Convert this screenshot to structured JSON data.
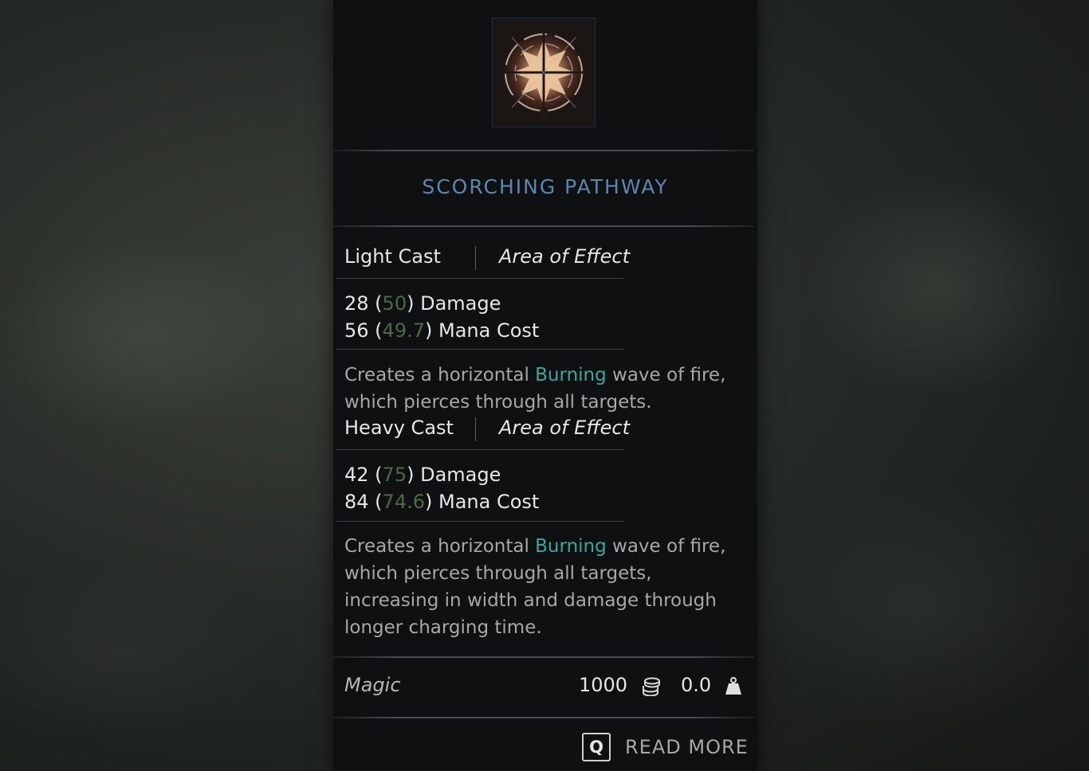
{
  "skill": {
    "name": "SCORCHING PATHWAY",
    "icon": "fire-burst-icon"
  },
  "light_cast": {
    "label": "Light Cast",
    "type": "Area of Effect",
    "damage_base": "28",
    "damage_scaled": "50",
    "damage_label": "Damage",
    "mana_base": "56",
    "mana_scaled": "49.7",
    "mana_label": "Mana Cost",
    "desc_pre": "Creates a horizontal ",
    "desc_keyword": "Burning",
    "desc_post": " wave of fire, which pierces through all targets."
  },
  "heavy_cast": {
    "label": "Heavy Cast",
    "type": "Area of Effect",
    "damage_base": "42",
    "damage_scaled": "75",
    "damage_label": "Damage",
    "mana_base": "84",
    "mana_scaled": "74.6",
    "mana_label": "Mana Cost",
    "desc_pre": "Creates a horizontal ",
    "desc_keyword": "Burning",
    "desc_post": " wave of fire, which pierces through all targets, increasing in width and damage through longer charging time."
  },
  "footer": {
    "category": "Magic",
    "price": "1000",
    "weight": "0.0"
  },
  "read_more": {
    "key": "Q",
    "label": "READ MORE"
  },
  "colors": {
    "title": "#5b86b0",
    "scaled_value": "#4b6a43",
    "keyword": "#3aa79a",
    "panel_bg": "#0f1011"
  }
}
